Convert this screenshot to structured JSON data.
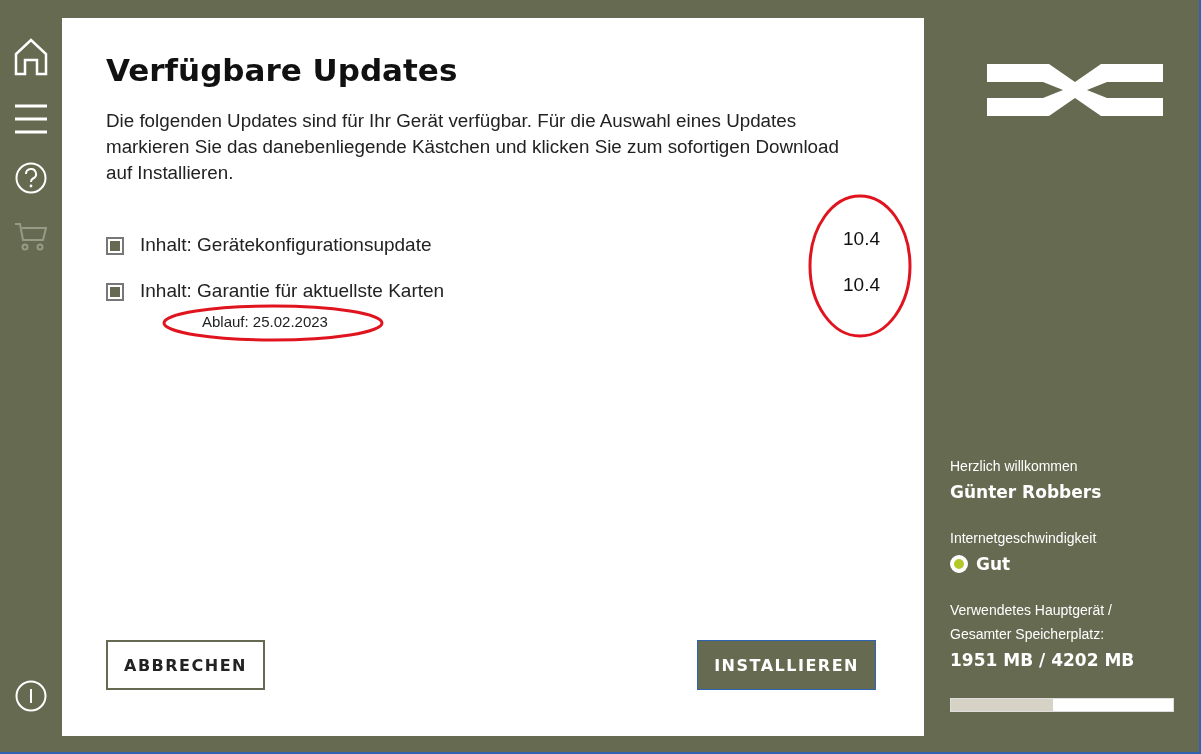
{
  "nav": [
    {
      "kind": "home",
      "disabled": false
    },
    {
      "kind": "menu",
      "disabled": false
    },
    {
      "kind": "help",
      "disabled": false
    },
    {
      "kind": "cart",
      "disabled": true
    },
    {
      "kind": "info",
      "disabled": false
    }
  ],
  "dialog": {
    "title": "Verfügbare Updates",
    "description": "Die folgenden Updates sind für Ihr Gerät verfügbar. Für die Auswahl eines Updates markieren Sie das danebenliegende Kästchen und klicken Sie zum sofortigen Download auf Installieren.",
    "updates": [
      {
        "label": "Inhalt: Gerätekonfigurationsupdate",
        "version": "10.4",
        "checked": true
      },
      {
        "label": "Inhalt: Garantie für aktuellste Karten",
        "version": "10.4",
        "checked": true,
        "note": "Ablauf: 25.02.2023"
      }
    ],
    "buttons": [
      {
        "label": "ABBRECHEN",
        "kind": "secondary"
      },
      {
        "label": "INSTALLIEREN",
        "kind": "primary"
      }
    ]
  },
  "account": {
    "greeting": "Herzlich willkommen",
    "name": "Günter Robbers",
    "speed_label": "Internetgeschwindigkeit",
    "speed_value": "Gut",
    "storage_label_1": "Verwendetes Hauptgerät /",
    "storage_label_2": "Gesamter Speicherplatz:",
    "storage_value": "1951 MB / 4202 MB",
    "storage": {
      "level": 0.46
    }
  }
}
